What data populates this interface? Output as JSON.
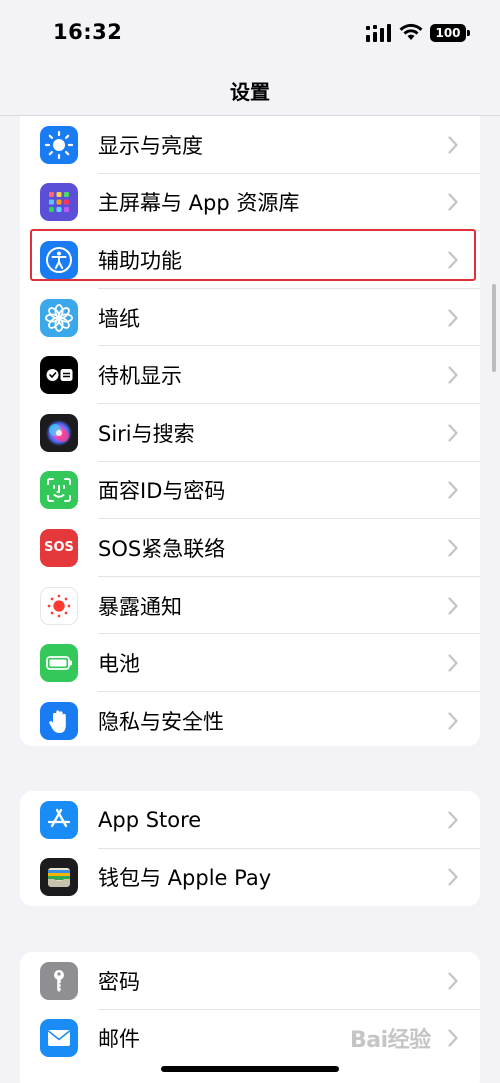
{
  "status_bar": {
    "time": "16:32",
    "battery": "100"
  },
  "nav": {
    "title": "设置"
  },
  "group1": [
    {
      "label": "显示与亮度",
      "icon": "brightness-icon",
      "color": "#1a7cf2"
    },
    {
      "label": "主屏幕与 App 资源库",
      "icon": "home-screen-grid-icon",
      "color": "#5b4fd8"
    },
    {
      "label": "辅助功能",
      "icon": "accessibility-icon",
      "color": "#1a7cf2"
    },
    {
      "label": "墙纸",
      "icon": "wallpaper-flower-icon",
      "color": "#3aa8ea"
    },
    {
      "label": "待机显示",
      "icon": "standby-icon",
      "color": "#000000"
    },
    {
      "label": "Siri与搜索",
      "icon": "siri-icon",
      "color": "#222222"
    },
    {
      "label": "面容ID与密码",
      "icon": "face-id-icon",
      "color": "#34c759"
    },
    {
      "label": "SOS紧急联络",
      "icon": "sos-icon",
      "color": "#e5383b",
      "icon_text": "SOS"
    },
    {
      "label": "暴露通知",
      "icon": "exposure-notification-icon",
      "color": "#ffffff"
    },
    {
      "label": "电池",
      "icon": "battery-icon",
      "color": "#34c759"
    },
    {
      "label": "隐私与安全性",
      "icon": "privacy-hand-icon",
      "color": "#1a7cf2"
    }
  ],
  "group2": [
    {
      "label": "App Store",
      "icon": "app-store-icon",
      "color": "#1a8cf5"
    },
    {
      "label": "钱包与 Apple Pay",
      "icon": "wallet-icon",
      "color": "#1c1c1e"
    }
  ],
  "group3": [
    {
      "label": "密码",
      "icon": "key-icon",
      "color": "#8e8e93"
    },
    {
      "label": "邮件",
      "icon": "mail-icon",
      "color": "#1a8cf5"
    }
  ],
  "highlight_color": "#e0313a",
  "watermark": "Bai经验"
}
